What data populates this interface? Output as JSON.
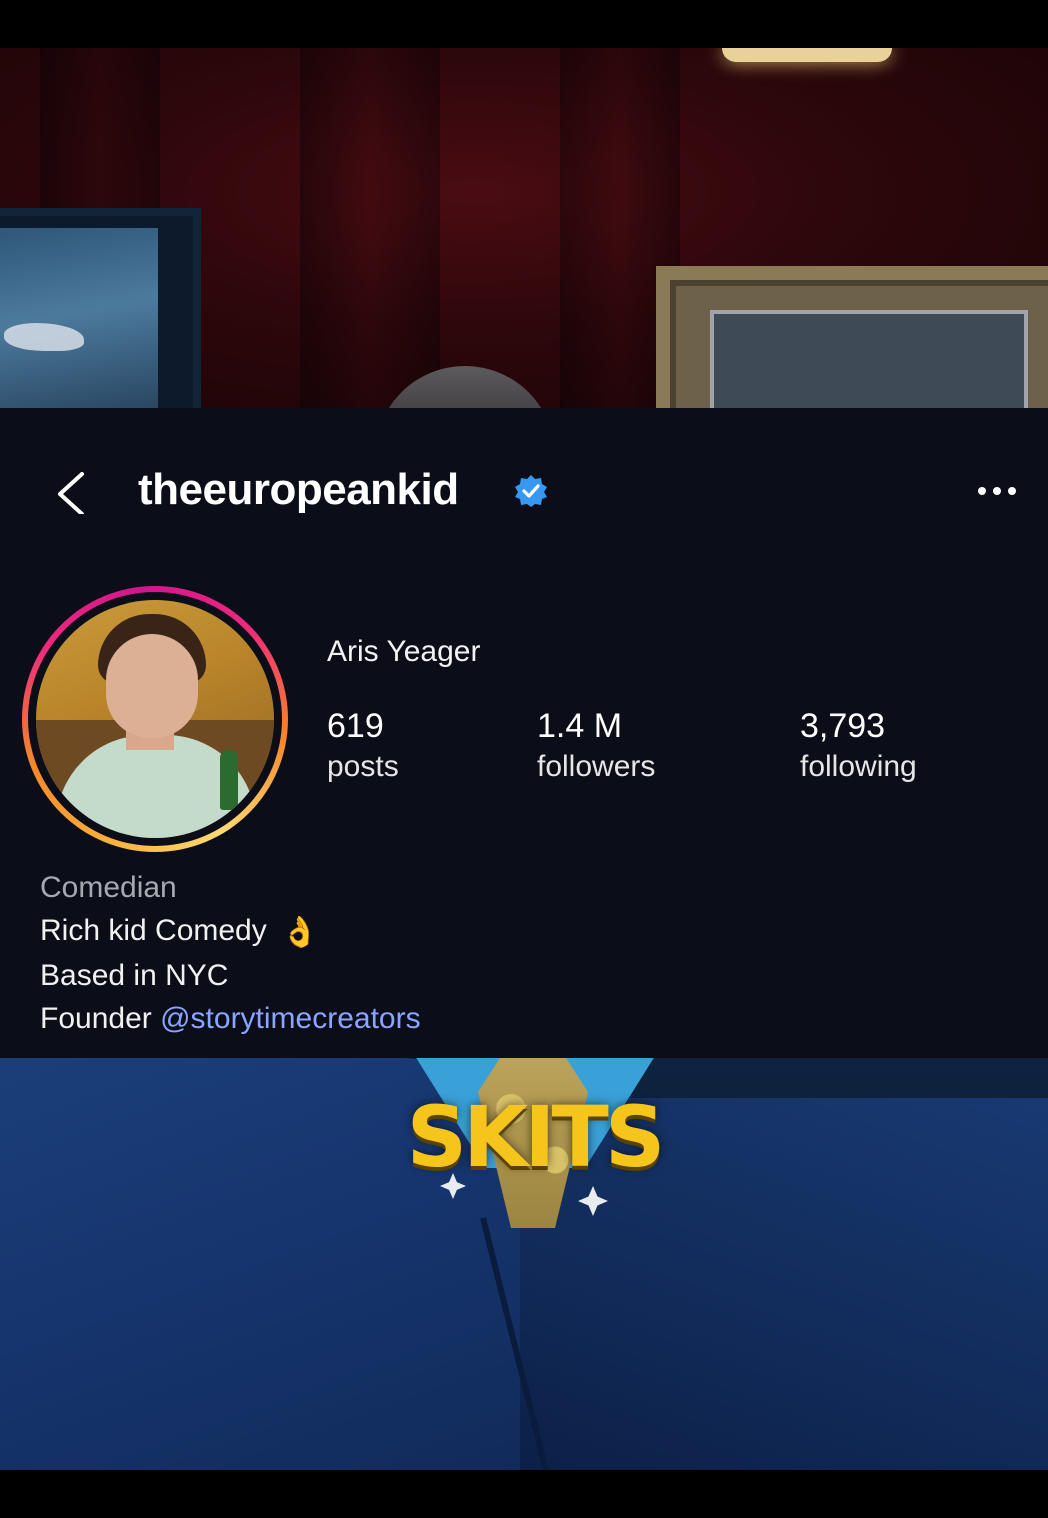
{
  "header": {
    "username": "theeuropeankid",
    "back_icon": "chevron-left-icon",
    "verified_icon": "verified-badge-icon",
    "more_icon": "more-horizontal-icon",
    "verified_color": "#3897f0"
  },
  "profile": {
    "display_name": "Aris Yeager",
    "avatar_ring_colors": [
      "#feda75",
      "#f58529",
      "#dd2a7b",
      "#d3148f"
    ],
    "stats": [
      {
        "value": "619",
        "label": "posts"
      },
      {
        "value": "1.4 M",
        "label": "followers"
      },
      {
        "value": "3,793",
        "label": "following"
      }
    ]
  },
  "bio": {
    "category": "Comedian",
    "line1": "Rich kid Comedy",
    "line1_emoji": "👌",
    "line2": "Based in NYC",
    "line3_prefix": "Founder",
    "mention": "@storytimecreators",
    "mention_color": "#8aa4ff"
  },
  "video": {
    "caption": "SKITS",
    "caption_color": "#f6c51c"
  }
}
